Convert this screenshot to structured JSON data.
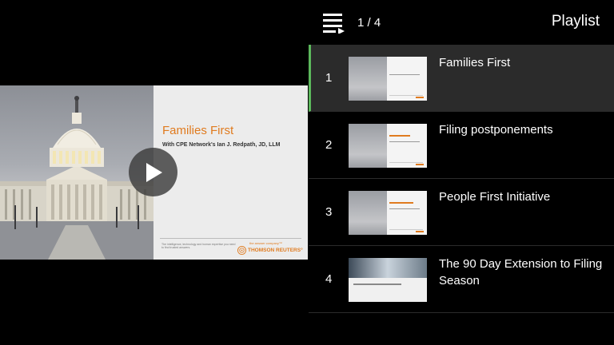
{
  "player": {
    "slide": {
      "title": "Families First",
      "subtitle": "With CPE Network's Ian J. Redpath, JD, LLM",
      "tagline": "The intelligence, technology and human expertise you need to find trusted answers.",
      "answer_company": "the answer company™",
      "logo_text": "THOMSON REUTERS°"
    },
    "play_icon": "play-icon"
  },
  "playlist": {
    "toggle_icon": "playlist-toggle-icon",
    "counter": "1 / 4",
    "title": "Playlist",
    "accent_color": "#5cb85c",
    "items": [
      {
        "number": "1",
        "label": "Families First",
        "active": true,
        "thumb": "capitol"
      },
      {
        "number": "2",
        "label": "Filing postponements",
        "active": false,
        "thumb": "capitol"
      },
      {
        "number": "3",
        "label": "People First Initiative",
        "active": false,
        "thumb": "capitol"
      },
      {
        "number": "4",
        "label": "The 90 Day Extension to Filing Season",
        "active": false,
        "thumb": "wave"
      }
    ]
  }
}
